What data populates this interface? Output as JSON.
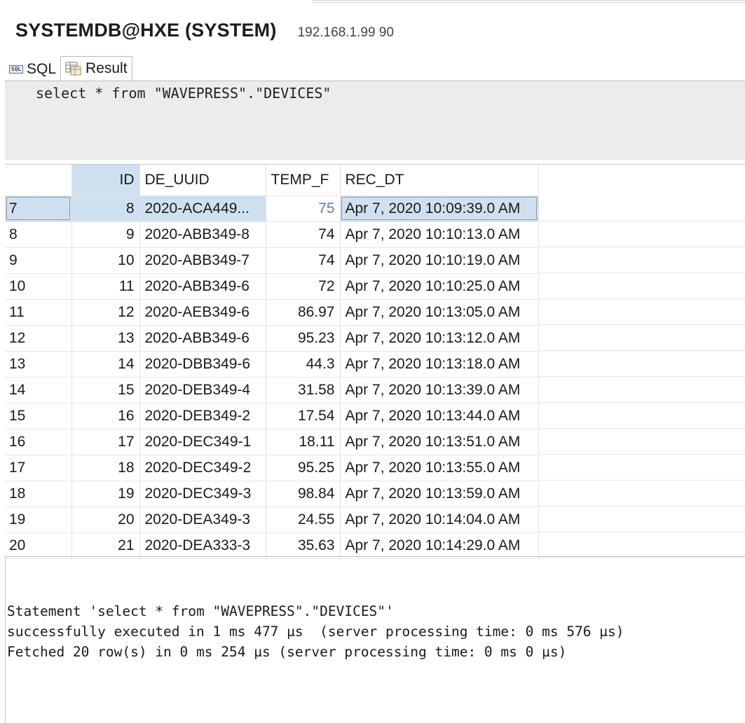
{
  "connection": {
    "title": "SYSTEMDB@HXE (SYSTEM)",
    "host": "192.168.1.99 90"
  },
  "tabs": [
    {
      "label": "SQL",
      "icon": "sql-icon"
    },
    {
      "label": "Result",
      "icon": "result-grid-icon",
      "active": true
    }
  ],
  "editor": {
    "query": "select * from \"WAVEPRESS\".\"DEVICES\""
  },
  "grid": {
    "columns": [
      "",
      "ID",
      "DE_UUID",
      "TEMP_F",
      "REC_DT"
    ],
    "rows": [
      {
        "n": "7",
        "id": "8",
        "uuid": "2020-ACA449...",
        "temp": "75",
        "rec": "Apr 7, 2020 10:09:39.0 AM",
        "selected": true
      },
      {
        "n": "8",
        "id": "9",
        "uuid": "2020-ABB349-8",
        "temp": "74",
        "rec": "Apr 7, 2020 10:10:13.0 AM"
      },
      {
        "n": "9",
        "id": "10",
        "uuid": "2020-ABB349-7",
        "temp": "74",
        "rec": "Apr 7, 2020 10:10:19.0 AM"
      },
      {
        "n": "10",
        "id": "11",
        "uuid": "2020-ABB349-6",
        "temp": "72",
        "rec": "Apr 7, 2020 10:10:25.0 AM"
      },
      {
        "n": "11",
        "id": "12",
        "uuid": "2020-AEB349-6",
        "temp": "86.97",
        "rec": "Apr 7, 2020 10:13:05.0 AM"
      },
      {
        "n": "12",
        "id": "13",
        "uuid": "2020-ABB349-6",
        "temp": "95.23",
        "rec": "Apr 7, 2020 10:13:12.0 AM"
      },
      {
        "n": "13",
        "id": "14",
        "uuid": "2020-DBB349-6",
        "temp": "44.3",
        "rec": "Apr 7, 2020 10:13:18.0 AM"
      },
      {
        "n": "14",
        "id": "15",
        "uuid": "2020-DEB349-4",
        "temp": "31.58",
        "rec": "Apr 7, 2020 10:13:39.0 AM"
      },
      {
        "n": "15",
        "id": "16",
        "uuid": "2020-DEB349-2",
        "temp": "17.54",
        "rec": "Apr 7, 2020 10:13:44.0 AM"
      },
      {
        "n": "16",
        "id": "17",
        "uuid": "2020-DEC349-1",
        "temp": "18.11",
        "rec": "Apr 7, 2020 10:13:51.0 AM"
      },
      {
        "n": "17",
        "id": "18",
        "uuid": "2020-DEC349-2",
        "temp": "95.25",
        "rec": "Apr 7, 2020 10:13:55.0 AM"
      },
      {
        "n": "18",
        "id": "19",
        "uuid": "2020-DEC349-3",
        "temp": "98.84",
        "rec": "Apr 7, 2020 10:13:59.0 AM"
      },
      {
        "n": "19",
        "id": "20",
        "uuid": "2020-DEA349-3",
        "temp": "24.55",
        "rec": "Apr 7, 2020 10:14:04.0 AM"
      },
      {
        "n": "20",
        "id": "21",
        "uuid": "2020-DEA333-3",
        "temp": "35.63",
        "rec": "Apr 7, 2020 10:14:29.0 AM"
      }
    ]
  },
  "status": {
    "lines": [
      "Statement 'select * from \"WAVEPRESS\".\"DEVICES\"'",
      "successfully executed in 1 ms 477 µs  (server processing time: 0 ms 576 µs)",
      "Fetched 20 row(s) in 0 ms 254 µs (server processing time: 0 ms 0 µs)"
    ]
  },
  "colors": {
    "selection": "#cfe0f1",
    "editor_bg": "#ececec"
  }
}
